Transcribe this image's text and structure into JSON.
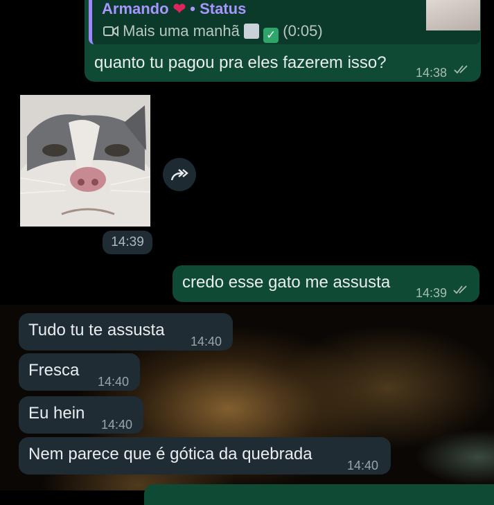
{
  "messages": [
    {
      "id": "m1",
      "direction": "outgoing",
      "reply": {
        "name": "Armando",
        "name_suffix": "• Status",
        "subtitle": "Mais uma manhã",
        "duration": "(0:05)"
      },
      "text": "quanto tu pagou pra eles fazerem isso?",
      "time": "14:38",
      "status": "read"
    },
    {
      "id": "m2",
      "direction": "incoming",
      "type": "sticker-image",
      "time": "14:39"
    },
    {
      "id": "m3",
      "direction": "outgoing",
      "text": "credo esse gato me assusta",
      "time": "14:39",
      "status": "read"
    },
    {
      "id": "m4",
      "direction": "incoming",
      "text": "Tudo tu te assusta",
      "time": "14:40"
    },
    {
      "id": "m5",
      "direction": "incoming",
      "text": "Fresca",
      "time": "14:40"
    },
    {
      "id": "m6",
      "direction": "incoming",
      "text": "Eu hein",
      "time": "14:40"
    },
    {
      "id": "m7",
      "direction": "incoming",
      "text": "Nem parece que é gótica da quebrada",
      "time": "14:40"
    }
  ],
  "colors": {
    "outgoing_bubble": "#0f4a35",
    "incoming_bubble": "#1f2c34",
    "reply_accent": "#9d88ff",
    "background": "#000000"
  }
}
